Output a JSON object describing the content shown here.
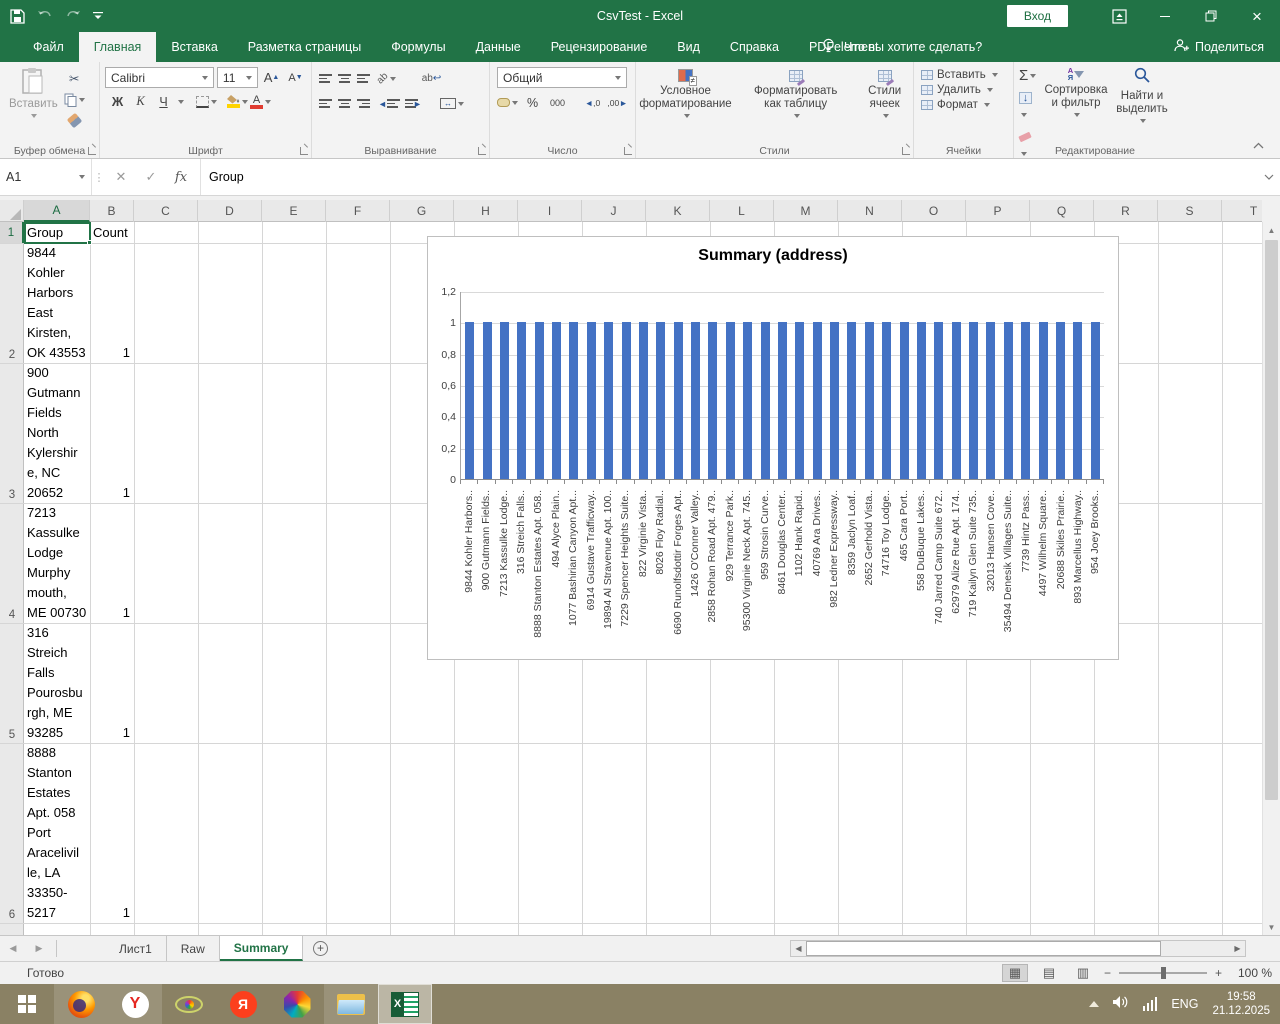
{
  "titlebar": {
    "title": "CsvTest - Excel",
    "signin_label": "Вход"
  },
  "ribbon": {
    "tabs": [
      {
        "label": "Файл",
        "active": false
      },
      {
        "label": "Главная",
        "active": true
      },
      {
        "label": "Вставка",
        "active": false
      },
      {
        "label": "Разметка страницы",
        "active": false
      },
      {
        "label": "Формулы",
        "active": false
      },
      {
        "label": "Данные",
        "active": false
      },
      {
        "label": "Рецензирование",
        "active": false
      },
      {
        "label": "Вид",
        "active": false
      },
      {
        "label": "Справка",
        "active": false
      },
      {
        "label": "PDFelement",
        "active": false
      }
    ],
    "search_label": "Что вы хотите сделать?",
    "share_label": "Поделиться",
    "clipboard": {
      "group_label": "Буфер обмена",
      "paste_label": "Вставить"
    },
    "font": {
      "group_label": "Шрифт",
      "font_name": "Calibri",
      "font_size": "11",
      "bold_label": "Ж",
      "italic_label": "К",
      "underline_label": "Ч"
    },
    "alignment": {
      "group_label": "Выравнивание",
      "wrap_label": "ab"
    },
    "number": {
      "group_label": "Число",
      "format": "Общий",
      "percent_label": "%",
      "thousands_label": "000"
    },
    "styles": {
      "group_label": "Стили",
      "conditional_label": "Условное форматирование",
      "format_table_label": "Форматировать как таблицу",
      "cell_styles_label": "Стили ячеек"
    },
    "cells": {
      "group_label": "Ячейки",
      "insert_label": "Вставить",
      "delete_label": "Удалить",
      "format_label": "Формат"
    },
    "editing": {
      "group_label": "Редактирование",
      "sum_label": "Σ",
      "sort_label": "Сортировка и фильтр",
      "find_label": "Найти и выделить"
    }
  },
  "formula_bar": {
    "name_box": "A1",
    "content": "Group"
  },
  "grid": {
    "columns": [
      "A",
      "B",
      "C",
      "D",
      "E",
      "F",
      "G",
      "H",
      "I",
      "J",
      "K",
      "L",
      "M",
      "N",
      "O",
      "P",
      "Q",
      "R",
      "S",
      "T"
    ],
    "rows": [
      {
        "n": "1",
        "lines": [
          "Group"
        ],
        "count": "Count"
      },
      {
        "n": "2",
        "lines": [
          "9844",
          "Kohler",
          "Harbors",
          "East",
          "Kirsten,",
          "OK 43553"
        ],
        "count": "1"
      },
      {
        "n": "3",
        "lines": [
          "900",
          "Gutmann",
          "Fields",
          "North",
          "Kylershir",
          "e, NC",
          "20652"
        ],
        "count": "1"
      },
      {
        "n": "4",
        "lines": [
          "7213",
          "Kassulke",
          "Lodge",
          "Murphy",
          "mouth,",
          "ME 00730"
        ],
        "count": "1"
      },
      {
        "n": "5",
        "lines": [
          "316",
          "Streich",
          "Falls",
          "Pourosbu",
          "rgh, ME",
          "93285"
        ],
        "count": "1"
      },
      {
        "n": "6",
        "lines": [
          "8888",
          "Stanton",
          "Estates",
          "Apt. 058",
          "Port",
          "Aracelivil",
          "le, LA",
          "33350-",
          "5217"
        ],
        "count": "1"
      }
    ]
  },
  "chart_data": {
    "type": "bar",
    "title": "Summary (address)",
    "categories": [
      "9844 Kohler Harbors..",
      "900 Gutmann Fields..",
      "7213 Kassulke Lodge..",
      "316 Streich Falls..",
      "8888 Stanton Estates Apt. 058..",
      "494 Alyce Plain..",
      "1077 Bashirian Canyon Apt...",
      "6914 Gustave Trafficway..",
      "19894 Al Stravenue Apt. 100..",
      "7229 Spencer Heights Suite..",
      "822 Virginie Vista..",
      "8026 Floy Radial..",
      "6690 Runolfsdottir Forges Apt..",
      "1426 O'Conner Valley..",
      "2858 Rohan Road Apt. 479..",
      "929 Terrance Park..",
      "95300 Virginie Neck Apt. 745..",
      "959 Strosin Curve..",
      "8461 Douglas Center..",
      "1102 Hank Rapid..",
      "40769 Ara Drives..",
      "982 Ledner Expressway..",
      "8359 Jaclyn Loaf..",
      "2652 Gerhold Vista..",
      "74716 Toy Lodge..",
      "465 Cara Port..",
      "558 DuBuque Lakes..",
      "740 Jarred Camp Suite 672..",
      "62979 Alize Rue Apt. 174..",
      "719 Kailyn Glen Suite 735..",
      "32013 Hansen Cove..",
      "35494 Denesik Villages Suite..",
      "7739 Hintz Pass..",
      "4497 Wilhelm Square..",
      "20688 Skiles Prairie..",
      "893 Marcellus Highway..",
      "954 Joey Brooks.."
    ],
    "values": [
      1,
      1,
      1,
      1,
      1,
      1,
      1,
      1,
      1,
      1,
      1,
      1,
      1,
      1,
      1,
      1,
      1,
      1,
      1,
      1,
      1,
      1,
      1,
      1,
      1,
      1,
      1,
      1,
      1,
      1,
      1,
      1,
      1,
      1,
      1,
      1,
      1
    ],
    "ylim": [
      0,
      1.2
    ],
    "yticks": [
      1.2,
      1,
      0.8,
      0.6,
      0.4,
      0.2,
      0
    ],
    "ytick_labels": [
      "1,2",
      "1",
      "0,8",
      "0,6",
      "0,4",
      "0,2",
      "0"
    ],
    "xlabel": "",
    "ylabel": "",
    "bar_color": "#4472C4",
    "grid": true,
    "legend": false
  },
  "sheet_tabs": {
    "items": [
      {
        "label": "Лист1",
        "active": false
      },
      {
        "label": "Raw",
        "active": false
      },
      {
        "label": "Summary",
        "active": true
      }
    ]
  },
  "status_bar": {
    "ready_label": "Готово",
    "zoom_level": "100 %"
  },
  "taskbar": {
    "apps": [
      {
        "name": "start",
        "active": false
      },
      {
        "name": "firefox",
        "active": false,
        "running": true
      },
      {
        "name": "yandex-browser",
        "active": false,
        "running": true
      },
      {
        "name": "eye-app",
        "active": false
      },
      {
        "name": "yandex",
        "active": false
      },
      {
        "name": "color-app",
        "active": false
      },
      {
        "name": "file-explorer",
        "active": false,
        "running": true
      },
      {
        "name": "excel",
        "active": true,
        "running": true
      }
    ],
    "tray": {
      "language": "ENG",
      "time": "19:58",
      "date": "21.12.2025"
    }
  }
}
